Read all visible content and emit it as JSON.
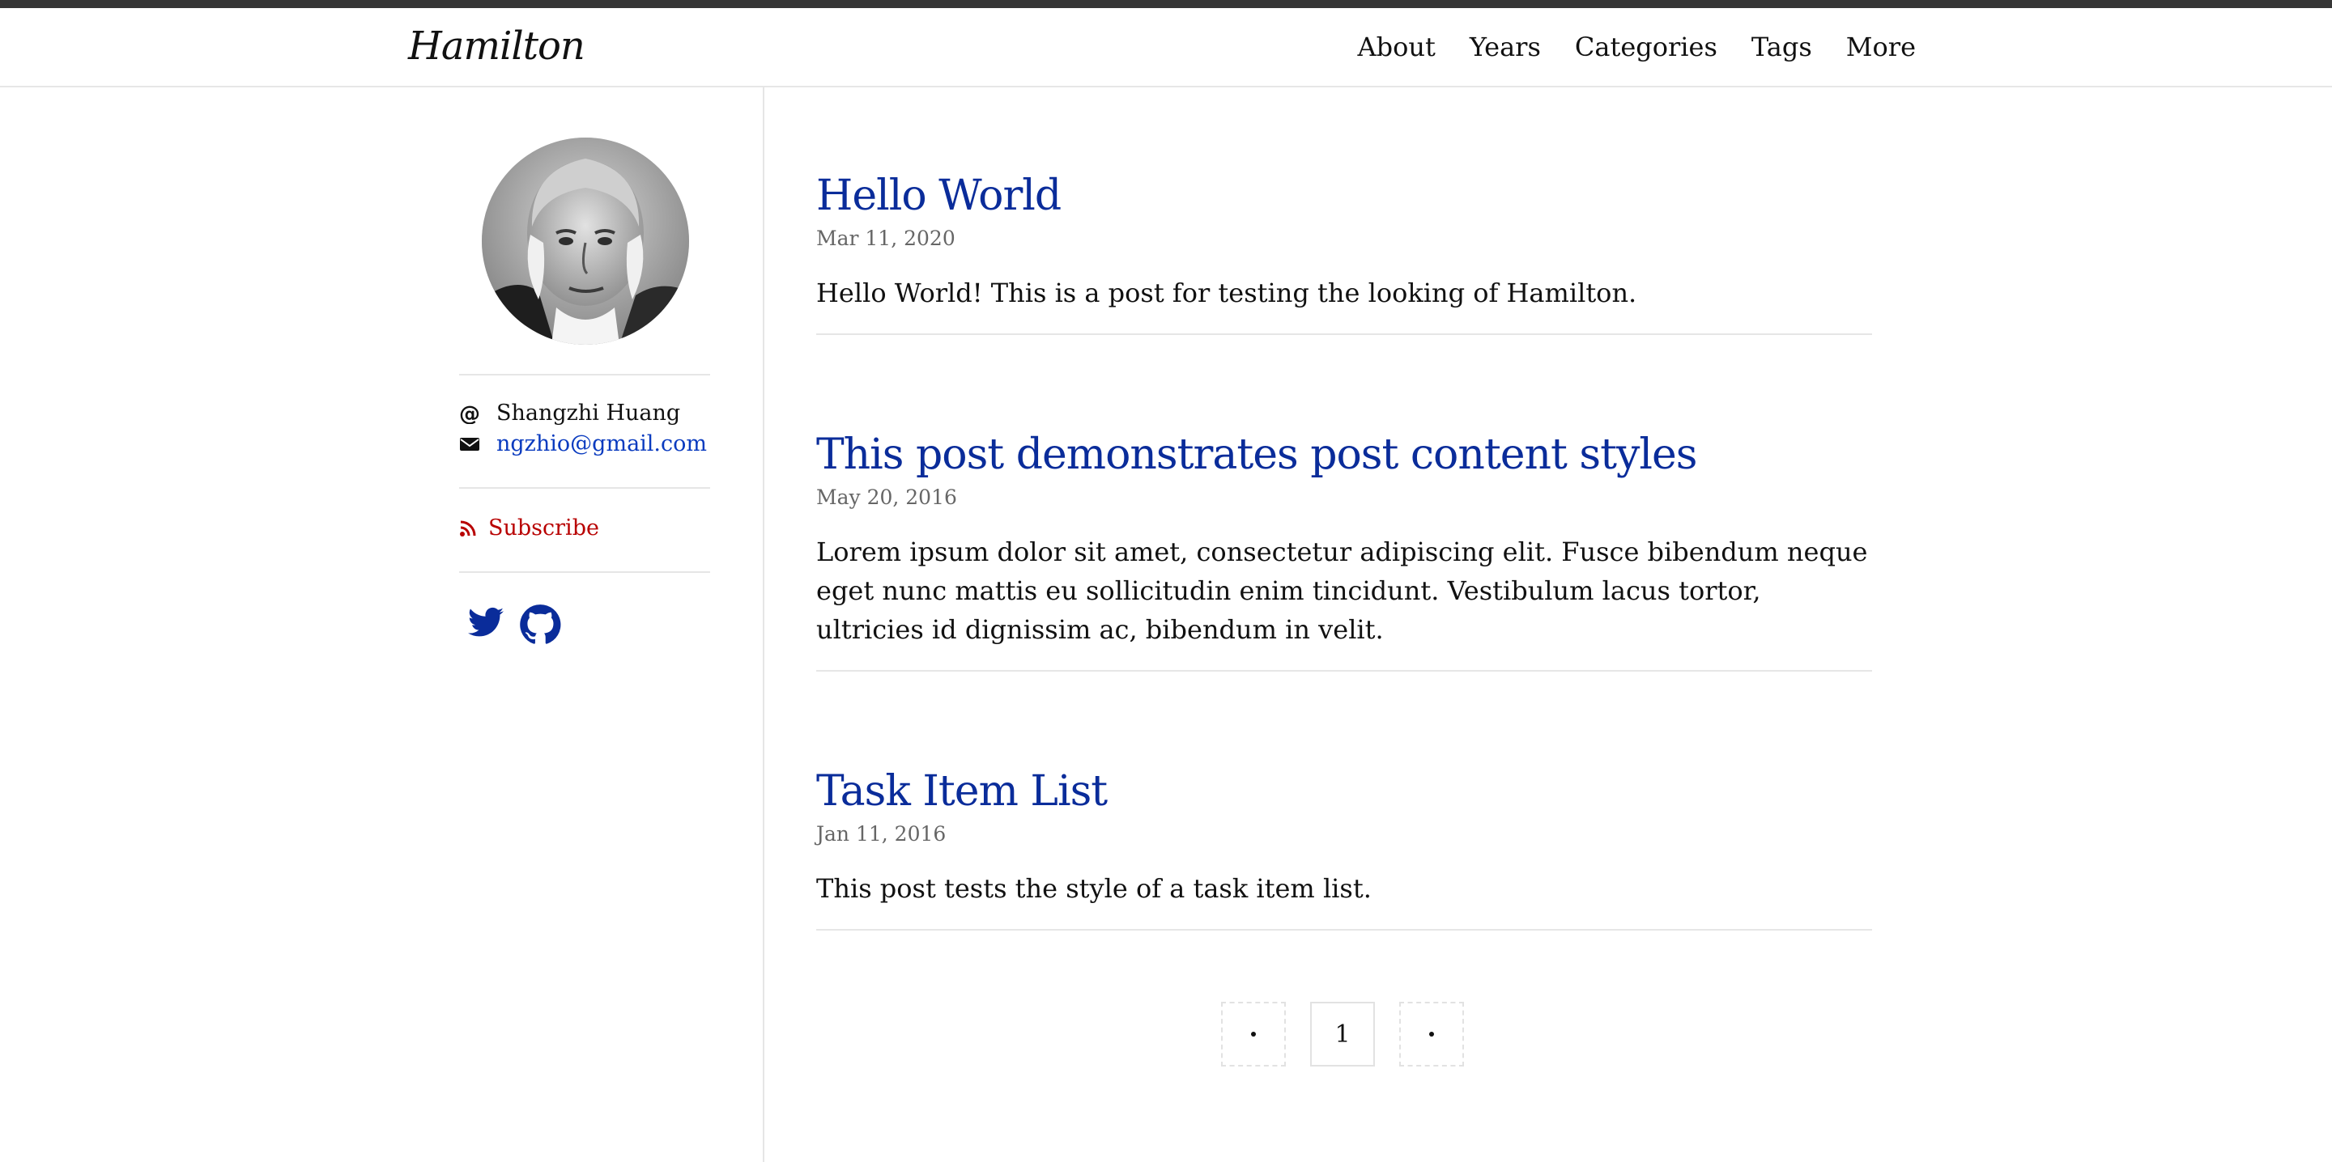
{
  "header": {
    "logo": "Hamilton",
    "nav": [
      "About",
      "Years",
      "Categories",
      "Tags",
      "More"
    ]
  },
  "sidebar": {
    "author_name": "Shangzhi Huang",
    "email": "ngzhio@gmail.com",
    "subscribe_label": "Subscribe",
    "social": [
      "twitter-icon",
      "github-icon"
    ]
  },
  "posts": [
    {
      "title": "Hello World",
      "date": "Mar 11, 2020",
      "excerpt": "Hello World! This is a post for testing the looking of Hamilton."
    },
    {
      "title": "This post demonstrates post content styles",
      "date": "May 20, 2016",
      "excerpt": "Lorem ipsum dolor sit amet, consectetur adipiscing elit. Fusce bibendum neque eget nunc mattis eu sollicitudin enim tincidunt. Vestibulum lacus tortor, ultricies id dignissim ac, bibendum in velit."
    },
    {
      "title": "Task Item List",
      "date": "Jan 11, 2016",
      "excerpt": "This post tests the style of a task item list."
    }
  ],
  "pagination": {
    "current_page": "1"
  },
  "colors": {
    "link": "#0a2c9a",
    "email": "#0a3bbf",
    "subscribe": "#b80000",
    "topbar": "#363636"
  }
}
